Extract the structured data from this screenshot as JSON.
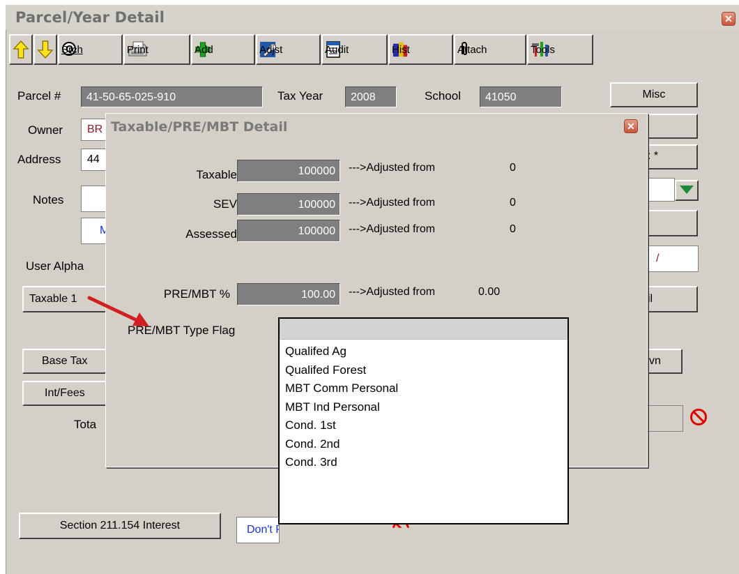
{
  "window": {
    "title": "Parcel/Year Detail"
  },
  "toolbar": {
    "up_icon": "up-arrow-icon",
    "down_icon": "down-arrow-icon",
    "search": "Srch",
    "print": "Print",
    "add": "Add",
    "adjust": "Adjst",
    "audit": "Audit",
    "history": "Hist",
    "attach": "Attach",
    "tools": "Tools"
  },
  "parcel": {
    "parcel_label": "Parcel #",
    "parcel_value": "41-50-65-025-910",
    "taxyear_label": "Tax Year",
    "taxyear_value": "2008",
    "school_label": "School",
    "school_value": "41050",
    "misc_button": "Misc",
    "owner_label": "Owner",
    "owner_value": "BR",
    "address_label": "Address",
    "address_value": "44",
    "notes_label": "Notes",
    "m_button": "M",
    "user_alpha_label": "User Alpha",
    "taxable_button": "Taxable 1",
    "base_tax_button": "Base Tax",
    "int_fees_button": "Int/Fees",
    "total_label": "Tota",
    "right_btn_asterisk": ": *",
    "right_slash": "/",
    "right_il": "il",
    "right_vn": "vn",
    "section_button": "Section 211.154 Interest",
    "dont_print_label": "Don't Print Notice?"
  },
  "dialog": {
    "title": "Taxable/PRE/MBT Detail",
    "rows": [
      {
        "label": "Taxable",
        "value": "100000",
        "adjusted_text": "--->Adjusted from",
        "adjusted_value": "0"
      },
      {
        "label": "SEV",
        "value": "100000",
        "adjusted_text": "--->Adjusted from",
        "adjusted_value": "0"
      },
      {
        "label": "Assessed",
        "value": "100000",
        "adjusted_text": "--->Adjusted from",
        "adjusted_value": "0"
      }
    ],
    "pre_label": "PRE/MBT %",
    "pre_value": "100.00",
    "pre_adjusted_text": "--->Adjusted from",
    "pre_adjusted_value": "0.00",
    "type_flag_label": "PRE/MBT Type Flag",
    "type_flag_selected": "",
    "type_flag_options": [
      "Qualifed Ag",
      "Qualifed Forest",
      "MBT Comm Personal",
      "MBT Ind Personal",
      "Cond. 1st",
      "Cond. 2nd",
      "Cond. 3rd"
    ]
  },
  "colors": {
    "annotation_arrow": "#d21f1f",
    "readonly_field": "#7f7f7f",
    "window": "#d4d0c8"
  }
}
